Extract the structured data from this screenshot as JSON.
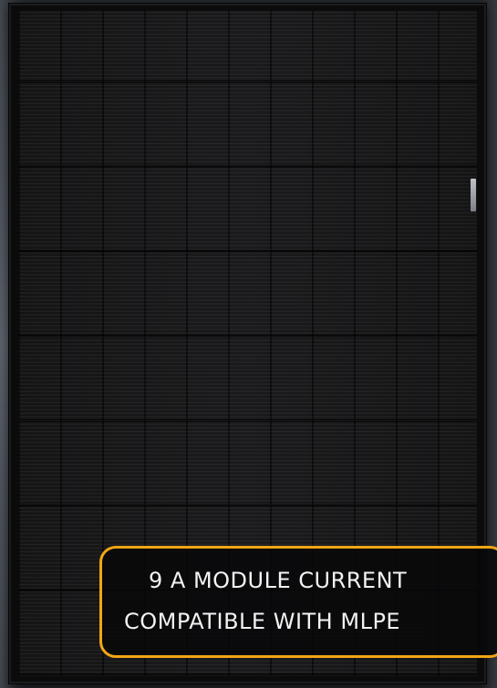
{
  "image": {
    "subject": "black solar panel",
    "accent_color": "#f2a516"
  },
  "callout": {
    "line1": "9 A MODULE CURRENT",
    "line2": "COMPATIBLE WITH MLPE"
  }
}
